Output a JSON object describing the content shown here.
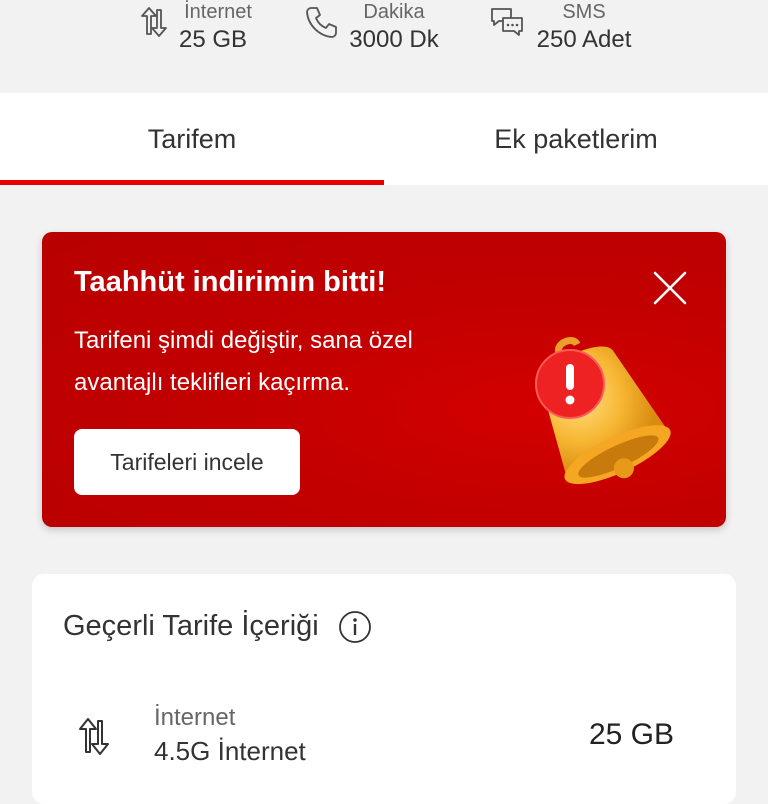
{
  "summary": {
    "items": [
      {
        "icon": "data-transfer-icon",
        "label": "İnternet",
        "value": "25 GB"
      },
      {
        "icon": "phone-icon",
        "label": "Dakika",
        "value": "3000 Dk"
      },
      {
        "icon": "chat-bubbles-icon",
        "label": "SMS",
        "value": "250 Adet"
      }
    ]
  },
  "tabs": [
    {
      "label": "Tarifem",
      "active": true
    },
    {
      "label": "Ek paketlerim",
      "active": false
    }
  ],
  "promo": {
    "title": "Taahhüt indirimin bitti!",
    "text": "Tarifeni şimdi değiştir, sana özel avantajlı teklifleri kaçırma.",
    "button_label": "Tarifeleri incele",
    "close_icon": "close-icon",
    "illustration": "bell-alert-icon",
    "background_color": "#c70000"
  },
  "tariff_card": {
    "title": "Geçerli Tarife İçeriği",
    "info_icon": "info-icon",
    "rows": [
      {
        "icon": "data-transfer-icon",
        "label": "İnternet",
        "sublabel": "4.5G İnternet",
        "value": "25 GB"
      }
    ]
  },
  "colors": {
    "accent": "#e60000",
    "background": "#f2f2f2",
    "card": "#ffffff"
  }
}
